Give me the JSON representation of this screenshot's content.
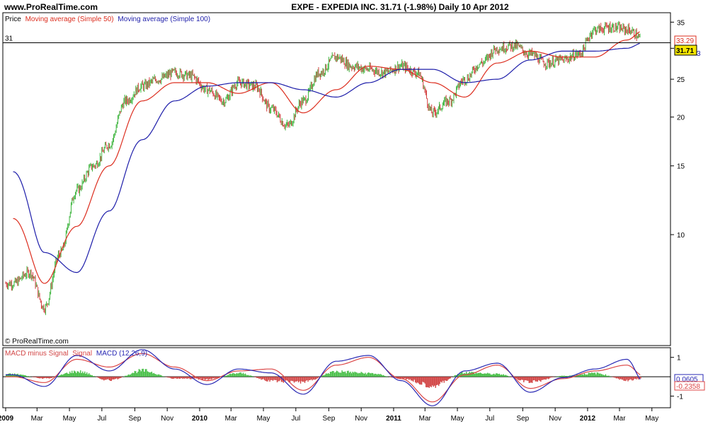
{
  "header": {
    "site": "www.ProRealTime.com",
    "title": "EXPE - EXPEDIA INC.    31.71  (-1.98%)    Daily  10 Apr 2012"
  },
  "price_panel": {
    "legend_price": "Price",
    "legend_ma50": "Moving average (Simple 50)",
    "legend_ma100": "Moving average (Simple 100)",
    "ref_line_label": "31",
    "copyright": "© ProRealTime.com",
    "last_price": "31.71",
    "ma50_value": "33.29",
    "ma100_value_partial": "3"
  },
  "macd_panel": {
    "legend_hist": "MACD minus Signal",
    "legend_signal": "Signal",
    "legend_macd": "MACD (12,26,9)",
    "value_top": "0.0605",
    "value_bottom": "-0.2358"
  },
  "colors": {
    "up": "#3cb43c",
    "down": "#d23c3c",
    "ma50": "#dc2d1e",
    "ma100": "#1e1eaa",
    "macd": "#2828b4",
    "signal": "#dc4646",
    "hist_pos": "#46be46",
    "hist_neg": "#d24646",
    "badge": "#f5e600"
  },
  "chart_data": [
    {
      "type": "line",
      "title": "EXPE - EXPEDIA INC.",
      "scale": "log",
      "ylim": [
        5.2,
        37
      ],
      "y_ticks": [
        10,
        15,
        20,
        25,
        30,
        35
      ],
      "x_ticks": [
        "2009",
        "Mar",
        "May",
        "Jul",
        "Sep",
        "Nov",
        "2010",
        "Mar",
        "May",
        "Jul",
        "Sep",
        "Nov",
        "2011",
        "Mar",
        "May",
        "Jul",
        "Sep",
        "Nov",
        "2012",
        "Mar",
        "May"
      ],
      "reference_line": 31,
      "series": [
        {
          "name": "Price",
          "dates": [
            "2009-01",
            "2009-02",
            "2009-03",
            "2009-04",
            "2009-05",
            "2009-06",
            "2009-07",
            "2009-08",
            "2009-09",
            "2009-10",
            "2009-11",
            "2009-12",
            "2010-01",
            "2010-02",
            "2010-03",
            "2010-04",
            "2010-05",
            "2010-06",
            "2010-07",
            "2010-08",
            "2010-09",
            "2010-10",
            "2010-11",
            "2010-12",
            "2011-01",
            "2011-02",
            "2011-03",
            "2011-04",
            "2011-05",
            "2011-06",
            "2011-07",
            "2011-08",
            "2011-09",
            "2011-10",
            "2011-11",
            "2011-12",
            "2012-01",
            "2012-02",
            "2012-03",
            "2012-04"
          ],
          "values": [
            7.5,
            8.0,
            6.5,
            9.0,
            13.0,
            15.0,
            17.0,
            22.0,
            24.0,
            25.0,
            26.0,
            25.5,
            23.5,
            22.0,
            24.5,
            24.0,
            21.0,
            19.0,
            22.0,
            26.0,
            28.5,
            27.0,
            26.5,
            26.0,
            27.0,
            26.0,
            20.5,
            22.0,
            25.0,
            27.5,
            30.0,
            30.5,
            29.0,
            27.5,
            28.0,
            29.0,
            33.5,
            34.0,
            33.5,
            31.71
          ]
        },
        {
          "name": "Moving average (Simple 50)",
          "dates": [
            "2009-01",
            "2009-03",
            "2009-05",
            "2009-07",
            "2009-09",
            "2009-11",
            "2010-01",
            "2010-03",
            "2010-05",
            "2010-07",
            "2010-09",
            "2010-11",
            "2011-01",
            "2011-03",
            "2011-05",
            "2011-07",
            "2011-09",
            "2011-11",
            "2012-01",
            "2012-03",
            "2012-04"
          ],
          "values": [
            11.0,
            7.5,
            10.5,
            15.0,
            22.0,
            24.5,
            24.5,
            23.0,
            24.5,
            20.5,
            23.5,
            27.0,
            26.5,
            24.5,
            22.5,
            27.5,
            29.5,
            28.5,
            28.5,
            31.5,
            33.29
          ]
        },
        {
          "name": "Moving average (Simple 100)",
          "dates": [
            "2009-01",
            "2009-03",
            "2009-05",
            "2009-07",
            "2009-09",
            "2009-11",
            "2010-01",
            "2010-03",
            "2010-05",
            "2010-07",
            "2010-09",
            "2010-11",
            "2011-01",
            "2011-03",
            "2011-05",
            "2011-07",
            "2011-09",
            "2011-11",
            "2012-01",
            "2012-03",
            "2012-04"
          ],
          "values": [
            14.5,
            9.0,
            8.0,
            11.5,
            17.5,
            22.0,
            24.0,
            24.5,
            24.5,
            23.5,
            22.5,
            24.5,
            26.5,
            26.5,
            24.5,
            25.0,
            28.0,
            29.5,
            29.5,
            30.0,
            31.0
          ]
        }
      ]
    },
    {
      "type": "line",
      "title": "MACD (12,26,9)",
      "ylim": [
        -1.6,
        1.5
      ],
      "y_ticks": [
        -1,
        1
      ],
      "series": [
        {
          "name": "MACD minus Signal",
          "type": "bar",
          "dates": [
            "2009-01",
            "2009-03",
            "2009-05",
            "2009-07",
            "2009-09",
            "2009-11",
            "2010-01",
            "2010-03",
            "2010-05",
            "2010-07",
            "2010-09",
            "2010-11",
            "2011-01",
            "2011-03",
            "2011-05",
            "2011-07",
            "2011-09",
            "2011-11",
            "2012-01",
            "2012-03",
            "2012-04"
          ],
          "values": [
            0.15,
            -0.1,
            0.3,
            -0.2,
            0.35,
            -0.1,
            -0.15,
            0.2,
            -0.25,
            -0.3,
            0.3,
            0.2,
            -0.1,
            -0.5,
            0.25,
            0.15,
            -0.3,
            0.05,
            0.2,
            -0.2,
            -0.1
          ]
        },
        {
          "name": "Signal",
          "dates": [
            "2009-01",
            "2009-03",
            "2009-05",
            "2009-07",
            "2009-09",
            "2009-11",
            "2010-01",
            "2010-03",
            "2010-05",
            "2010-07",
            "2010-09",
            "2010-11",
            "2011-01",
            "2011-03",
            "2011-05",
            "2011-07",
            "2011-09",
            "2011-11",
            "2012-01",
            "2012-03",
            "2012-04"
          ],
          "values": [
            0.0,
            -0.3,
            0.9,
            0.5,
            1.2,
            0.5,
            -0.2,
            0.3,
            0.4,
            -0.7,
            0.6,
            1.0,
            -0.1,
            -1.3,
            0.1,
            0.6,
            -0.6,
            -0.1,
            0.3,
            0.6,
            0.05
          ]
        },
        {
          "name": "MACD",
          "dates": [
            "2009-01",
            "2009-03",
            "2009-05",
            "2009-07",
            "2009-09",
            "2009-11",
            "2010-01",
            "2010-03",
            "2010-05",
            "2010-07",
            "2010-09",
            "2010-11",
            "2011-01",
            "2011-03",
            "2011-05",
            "2011-07",
            "2011-09",
            "2011-11",
            "2012-01",
            "2012-03",
            "2012-04"
          ],
          "values": [
            0.1,
            -0.5,
            1.1,
            0.3,
            1.4,
            0.4,
            -0.4,
            0.4,
            0.2,
            -0.9,
            0.8,
            1.1,
            -0.2,
            -1.5,
            0.3,
            0.7,
            -0.8,
            -0.05,
            0.4,
            0.9,
            -0.2358
          ]
        }
      ]
    }
  ]
}
